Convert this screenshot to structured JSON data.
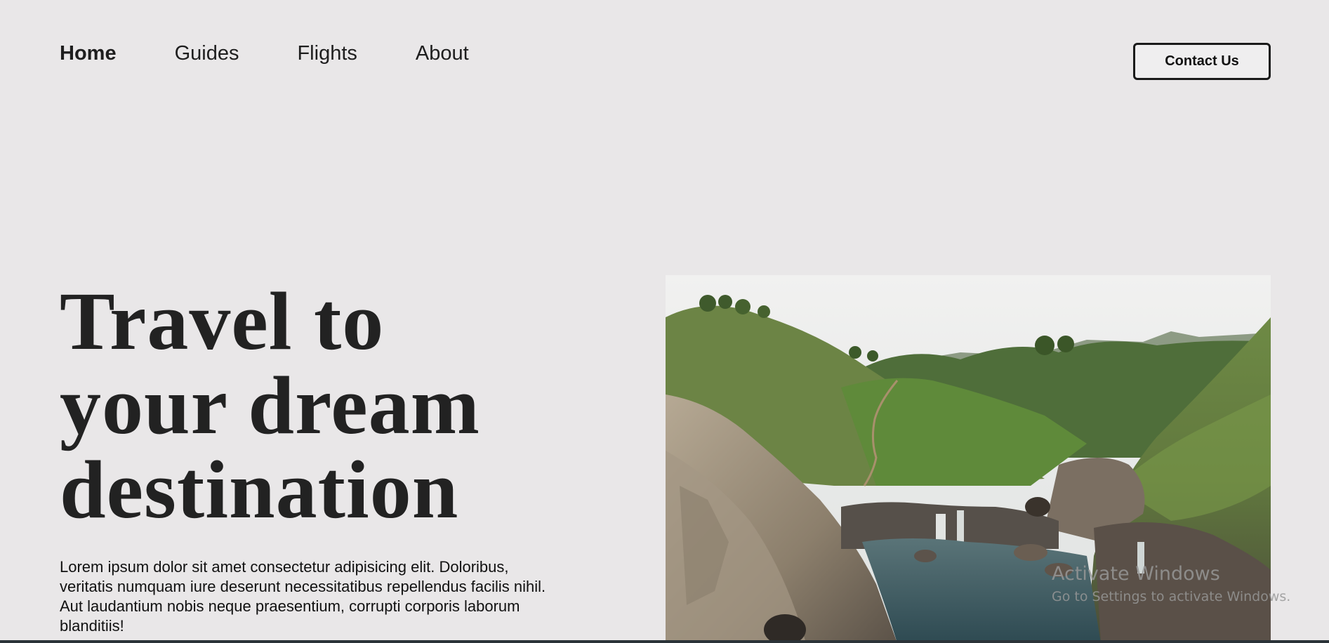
{
  "nav": {
    "items": [
      {
        "label": "Home",
        "active": true
      },
      {
        "label": "Guides",
        "active": false
      },
      {
        "label": "Flights",
        "active": false
      },
      {
        "label": "About",
        "active": false
      }
    ]
  },
  "header": {
    "contact_label": "Contact Us"
  },
  "hero": {
    "headline_lines": [
      "Travel to",
      "your dream",
      "destination"
    ],
    "body": "Lorem ipsum dolor sit amet consectetur adipisicing elit. Doloribus, veritatis numquam iure deserunt necessitatibus repellendus facilis nihil. Aut laudantium nobis neque praesentium, corrupti corporis laborum blanditiis!"
  },
  "watermark": {
    "title": "Activate Windows",
    "subtitle": "Go to Settings to activate Windows."
  },
  "colors": {
    "background": "#e9e7e8",
    "text": "#1e1e1e",
    "button_border": "#1a1a1a"
  }
}
